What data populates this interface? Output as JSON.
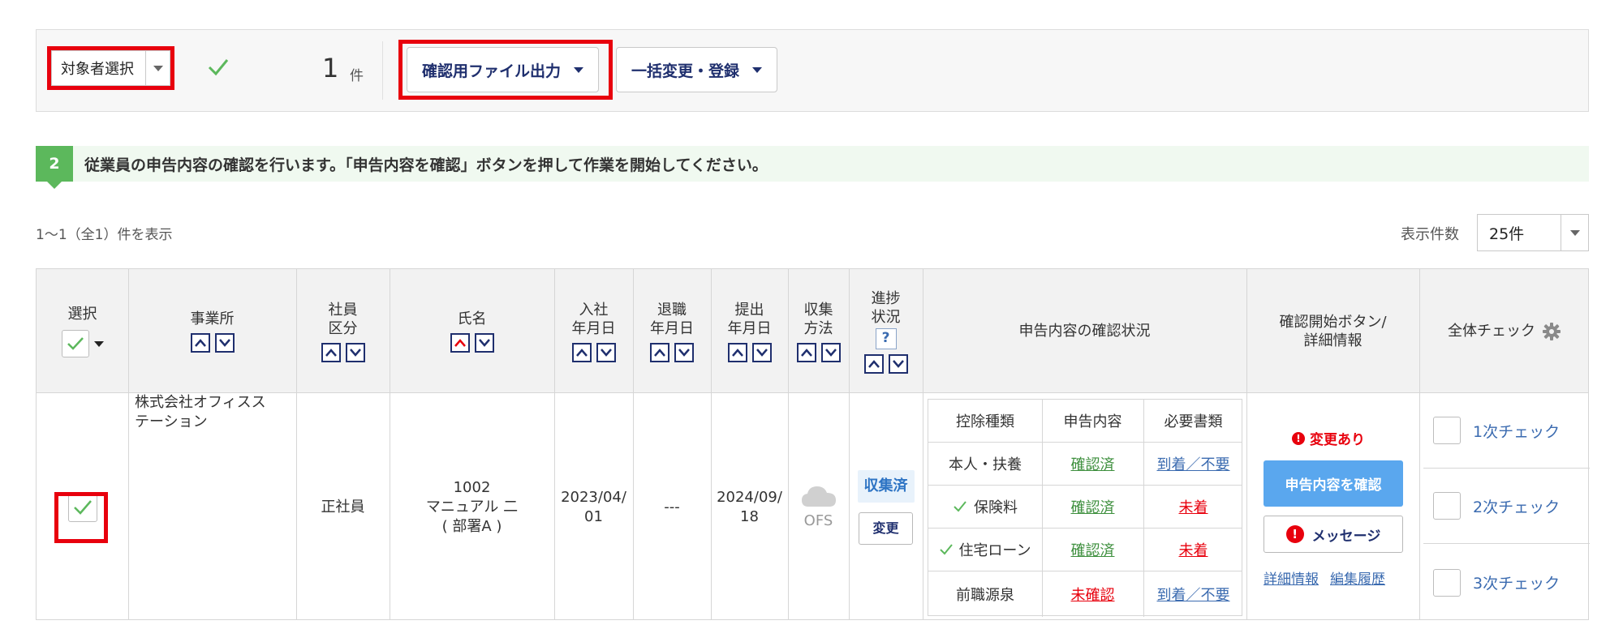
{
  "toolbar": {
    "select_target_label": "対象者選択",
    "count": "1",
    "count_unit": "件",
    "file_output_label": "確認用ファイル出力",
    "bulk_label": "一括変更・登録"
  },
  "step": {
    "number": "2",
    "text": "従業員の申告内容の確認を行います。「申告内容を確認」ボタンを押して作業を開始してください。"
  },
  "list": {
    "range_text": "1～1（全1）件を表示",
    "page_size_label": "表示件数",
    "page_size_value": "25件"
  },
  "table": {
    "headers": {
      "select": "選択",
      "office": "事業所",
      "emp_type_1": "社員",
      "emp_type_2": "区分",
      "name": "氏名",
      "join_1": "入社",
      "join_2": "年月日",
      "retire_1": "退職",
      "retire_2": "年月日",
      "submit_1": "提出",
      "submit_2": "年月日",
      "collect_1": "収集",
      "collect_2": "方法",
      "progress_1": "進捗",
      "progress_2": "状況",
      "help": "?",
      "status": "申告内容の確認状況",
      "confirm_1": "確認開始ボタン/",
      "confirm_2": "詳細情報",
      "allcheck": "全体チェック"
    },
    "row": {
      "office_1": "株式会社オフィスス",
      "office_2": "テーション",
      "emp_type": "正社員",
      "emp_no": "1002",
      "name": "マニュアル 二",
      "dept": "( 部署A )",
      "join_1": "2023/04/",
      "join_2": "01",
      "retire": "---",
      "submit_1": "2024/09/",
      "submit_2": "18",
      "collect": "OFS",
      "progress_chip": "収集済",
      "progress_btn": "変更",
      "status_headers": [
        "控除種類",
        "申告内容",
        "必要書類"
      ],
      "status_rows": [
        {
          "type": "本人・扶養",
          "decl": "確認済",
          "docs": "到着／不要"
        },
        {
          "type": "保険料",
          "decl": "確認済",
          "docs": "未着"
        },
        {
          "type": "住宅ローン",
          "decl": "確認済",
          "docs": "未着"
        },
        {
          "type": "前職源泉",
          "decl": "未確認",
          "docs": "到着／不要"
        }
      ],
      "change_flag": "変更あり",
      "confirm_btn": "申告内容を確認",
      "message_btn": "メッセージ",
      "detail_link": "詳細情報",
      "history_link": "編集履歴",
      "check1": "1次チェック",
      "check2": "2次チェック",
      "check3": "3次チェック"
    }
  },
  "colors": {
    "accent_red": "#e8000d",
    "check_green": "#5cb85c",
    "navy": "#1f2f6e",
    "link_blue": "#3b6bb0",
    "primary_btn": "#5aa7ee"
  }
}
